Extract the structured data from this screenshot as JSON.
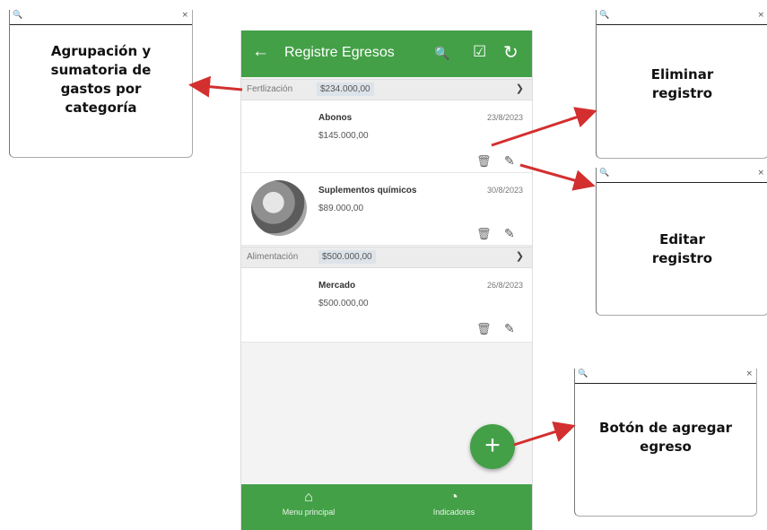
{
  "callouts": {
    "group": {
      "text": "Agrupación y sumatoria de gastos por categoría"
    },
    "delete": {
      "text": "Eliminar registro"
    },
    "edit": {
      "text": "Editar registro"
    },
    "add": {
      "text": "Botón de agregar egreso"
    },
    "search_glyph": "🔍",
    "close_glyph": "×"
  },
  "app": {
    "title": "Registre Egresos",
    "back_glyph": "←",
    "search_glyph": "🔍",
    "check_glyph": "☑",
    "refresh_glyph": "↻",
    "groups": [
      {
        "name": "Fertlización",
        "total": "$234.000,00",
        "info_glyph": "❯",
        "items": [
          {
            "name": "Abonos",
            "amount": "$145.000,00",
            "date": "23/8/2023",
            "has_image": false
          },
          {
            "name": "Suplementos químicos",
            "amount": "$89.000,00",
            "date": "30/8/2023",
            "has_image": true
          }
        ]
      },
      {
        "name": "Alimentación",
        "total": "$500.000,00",
        "info_glyph": "❯",
        "items": [
          {
            "name": "Mercado",
            "amount": "$500.000,00",
            "date": "26/8/2023",
            "has_image": false
          }
        ]
      }
    ],
    "trash_glyph": "🗑",
    "edit_glyph": "✎",
    "fab_glyph": "+",
    "nav": [
      {
        "label": "Menu principal",
        "icon": "home-icon",
        "glyph": "⌂"
      },
      {
        "label": "Indicadores",
        "icon": "chart-icon",
        "glyph": "◔"
      }
    ]
  },
  "colors": {
    "primary": "#43a047",
    "arrow": "#d32f2f"
  }
}
